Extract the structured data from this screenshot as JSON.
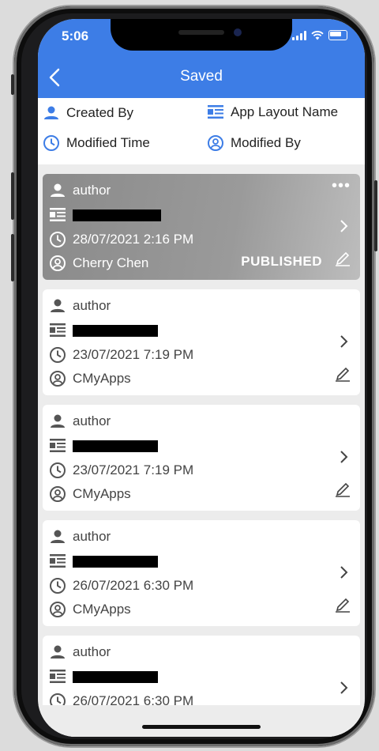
{
  "status_bar": {
    "time": "5:06"
  },
  "nav": {
    "title": "Saved"
  },
  "legend": {
    "created_by": "Created By",
    "app_layout_name": "App Layout Name",
    "modified_time": "Modified Time",
    "modified_by": "Modified By"
  },
  "cards": [
    {
      "author": "author",
      "datetime": "28/07/2021 2:16 PM",
      "modified_by": "Cherry Chen",
      "status": "PUBLISHED",
      "more": "•••"
    },
    {
      "author": "author",
      "datetime": "23/07/2021 7:19 PM",
      "modified_by": "CMyApps"
    },
    {
      "author": "author",
      "datetime": "23/07/2021 7:19 PM",
      "modified_by": "CMyApps"
    },
    {
      "author": "author",
      "datetime": "26/07/2021 6:30 PM",
      "modified_by": "CMyApps"
    },
    {
      "author": "author",
      "datetime": "26/07/2021 6:30 PM"
    }
  ],
  "colors": {
    "accent": "#3d7de6",
    "published_gradient": "#8a8a8a"
  },
  "icons": [
    "person-icon",
    "layout-icon",
    "clock-icon",
    "user-circle-icon",
    "chevron-right-icon",
    "pencil-icon",
    "more-icon",
    "back-chevron-icon"
  ]
}
